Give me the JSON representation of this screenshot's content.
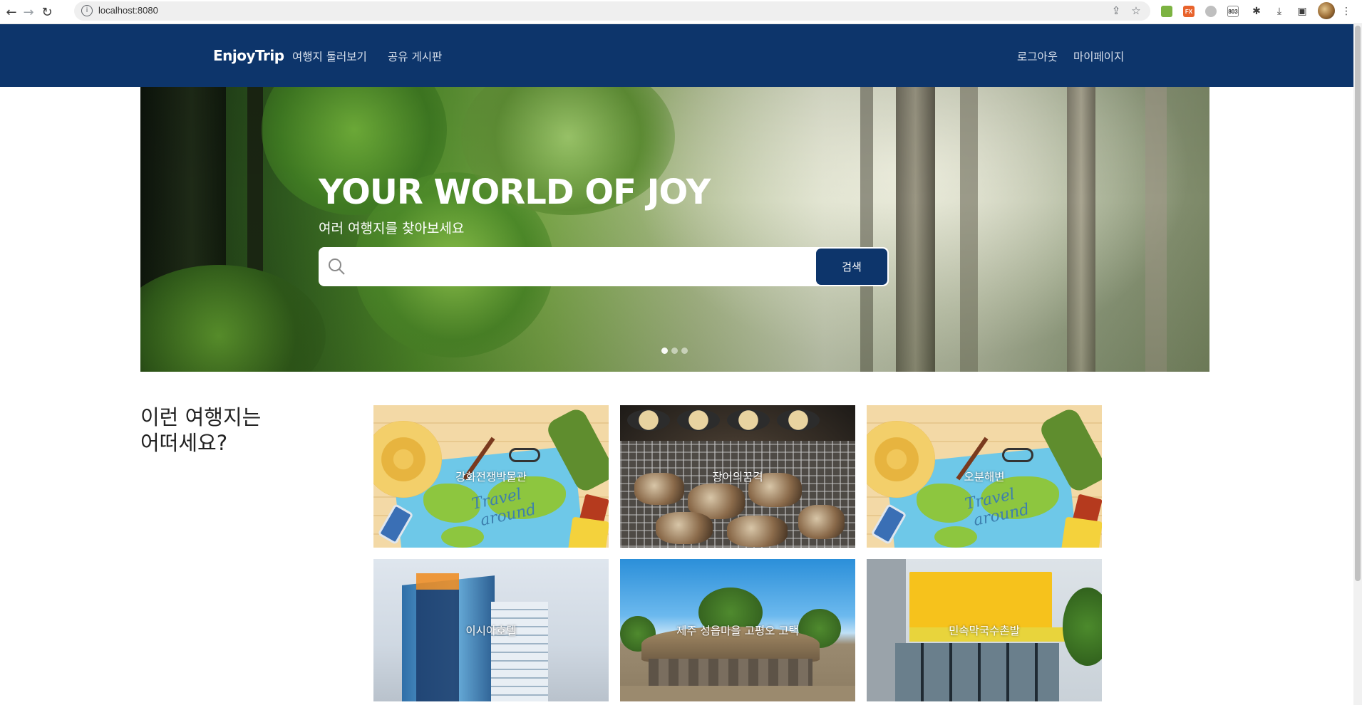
{
  "browser": {
    "url": "localhost:8080",
    "extensions": [
      "image-ext-icon",
      "fx-ext-icon",
      "github-ext-icon",
      "803"
    ]
  },
  "header": {
    "brand": "EnjoyTrip",
    "nav": [
      "여행지 둘러보기",
      "공유 게시판"
    ],
    "user_nav": [
      "로그아웃",
      "마이페이지"
    ]
  },
  "hero": {
    "title": "YOUR WORLD OF JOY",
    "subtitle": "여러 여행지를 찾아보세요",
    "search_placeholder": "",
    "search_button": "검색",
    "carousel_pages": 3,
    "carousel_active": 1
  },
  "recommend": {
    "heading_line1": "이런 여행지는",
    "heading_line2": "어떠세요?",
    "cards": [
      {
        "name": "강화전쟁박물관",
        "image": "travel-map"
      },
      {
        "name": "장어의꿈격",
        "image": "bbq-grill"
      },
      {
        "name": "오분해변",
        "image": "travel-map"
      },
      {
        "name": "이시아호텔",
        "image": "hotel-building"
      },
      {
        "name": "제주 성읍마을 고평오 고택",
        "image": "thatched-house"
      },
      {
        "name": "민속막국수촌발",
        "image": "noodle-shop"
      }
    ]
  },
  "colors": {
    "primary": "#0d356b",
    "header_link": "#d8e0ec"
  }
}
